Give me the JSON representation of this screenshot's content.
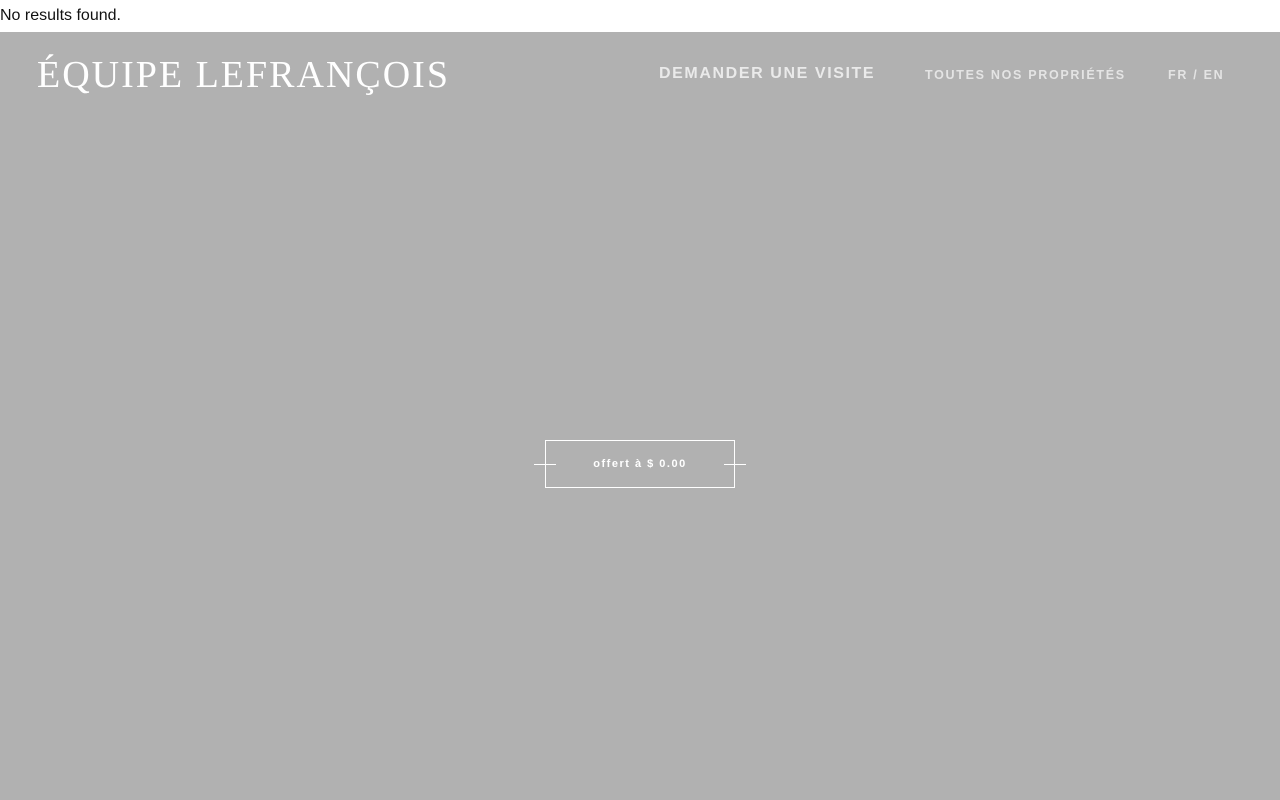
{
  "notice": {
    "text": "No results found."
  },
  "header": {
    "logo_text": "ÉQUIPE LEFRANÇOIS",
    "nav": {
      "visit_label": "DEMANDER UNE VISITE",
      "properties_label": "TOUTES NOS PROPRIÉTÉS"
    },
    "lang": {
      "fr": "FR",
      "separator": " / ",
      "en": "EN"
    }
  },
  "hero": {
    "background_color": "#b1b1b1",
    "offer_label": "offert à $ 0.00"
  }
}
